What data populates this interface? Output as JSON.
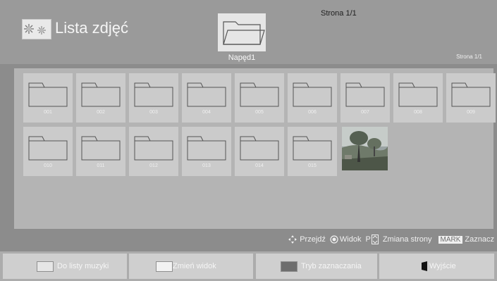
{
  "header": {
    "title": "Lista zdjęć",
    "drive_label": "Napęd1",
    "page_indicator_top": "Strona 1/1",
    "page_indicator_right": "Strona 1/1"
  },
  "grid": {
    "folders": [
      "001",
      "002",
      "003",
      "004",
      "005",
      "006",
      "007",
      "008",
      "009",
      "010",
      "011",
      "012",
      "013",
      "014",
      "015"
    ],
    "photo_icon": "landscape-photo-thumbnail"
  },
  "hints": {
    "navigate": "Przejdź",
    "view": "Widok",
    "page_key": "P",
    "page_change": "Zmiana strony",
    "mark_badge": "MARK",
    "mark": "Zaznacz"
  },
  "footer": {
    "music": {
      "label": "Do listy muzyki",
      "color": "#e6e6e6"
    },
    "view": {
      "label": "Zmień widok",
      "color": "#f2f2f2"
    },
    "select_mode": {
      "label": "Tryb zaznaczania",
      "color": "#6e6e6e"
    },
    "exit": {
      "label": "Wyjście"
    }
  }
}
